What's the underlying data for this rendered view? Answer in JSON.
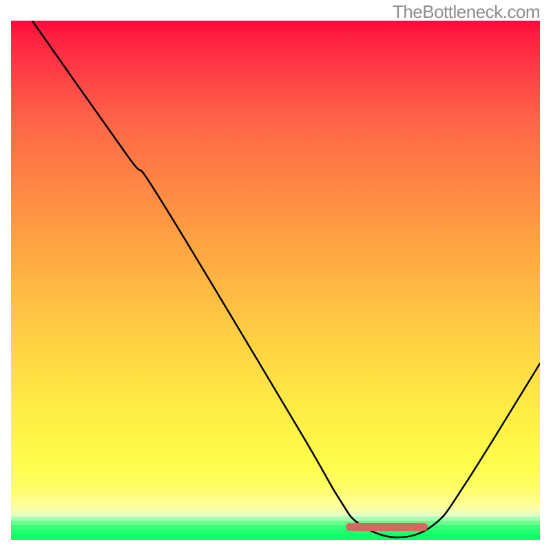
{
  "attribution": "TheBottleneck.com",
  "chart_data": {
    "type": "line",
    "title": "",
    "xlabel": "",
    "ylabel": "",
    "xlim": [
      0,
      100
    ],
    "ylim": [
      0,
      100
    ],
    "curve": [
      {
        "x": 4.0,
        "y": 100.0
      },
      {
        "x": 22.0,
        "y": 74.0
      },
      {
        "x": 28.0,
        "y": 66.0
      },
      {
        "x": 54.0,
        "y": 22.0
      },
      {
        "x": 62.0,
        "y": 8.0
      },
      {
        "x": 66.0,
        "y": 3.0
      },
      {
        "x": 73.0,
        "y": 0.5
      },
      {
        "x": 80.0,
        "y": 3.0
      },
      {
        "x": 86.0,
        "y": 11.0
      },
      {
        "x": 100.0,
        "y": 34.0
      }
    ],
    "optimal_marker": {
      "x_start": 64.0,
      "x_end": 78.0,
      "y": 2.5
    },
    "gradient_description": "vertical red-to-green via orange and yellow, with distinct green banding at the bottom"
  }
}
